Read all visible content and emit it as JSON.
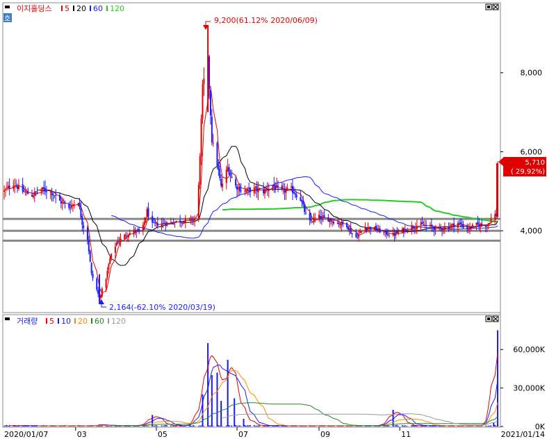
{
  "price_panel": {
    "legend": {
      "title": "이지홀딩스",
      "items": [
        {
          "label": "5",
          "color": "#e00000"
        },
        {
          "label": "20",
          "color": "#000000"
        },
        {
          "label": "60",
          "color": "#1a1aff"
        },
        {
          "label": "120",
          "color": "#22cc22"
        }
      ]
    },
    "corner_label": "호",
    "high_annotation": "9,200(61.12% 2020/06/09)",
    "low_annotation": "2,164(-62.10% 2020/03/19)",
    "current_price": "5,710",
    "current_change": "( 29.92%)",
    "y_ticks": [
      {
        "label": "8,000",
        "value": 8000
      },
      {
        "label": "6,000",
        "value": 6000
      },
      {
        "label": "4,000",
        "value": 4000
      }
    ],
    "support_lines": [
      4300,
      4000,
      3750
    ]
  },
  "volume_panel": {
    "legend": {
      "title": "거래량",
      "items": [
        {
          "label": "5",
          "color": "#e00000"
        },
        {
          "label": "10",
          "color": "#1a1aff"
        },
        {
          "label": "20",
          "color": "#ff8800"
        },
        {
          "label": "60",
          "color": "#228822"
        },
        {
          "label": "120",
          "color": "#999999"
        }
      ]
    },
    "y_ticks": [
      {
        "label": "60,000K",
        "value": 60000
      },
      {
        "label": "30,000K",
        "value": 30000
      },
      {
        "label": "0K",
        "value": 0
      }
    ]
  },
  "x_axis": {
    "start_label": "2020/01/07",
    "end_label": "2021/01/14",
    "ticks": [
      {
        "label": "03",
        "day": 54
      },
      {
        "label": "05",
        "day": 115
      },
      {
        "label": "07",
        "day": 176
      },
      {
        "label": "09",
        "day": 238
      },
      {
        "label": "11",
        "day": 299
      }
    ]
  },
  "chart_data": {
    "type": "candlestick",
    "x_range": [
      "2020/01/07",
      "2021/01/14"
    ],
    "ylim": [
      2000,
      9700
    ],
    "volume_ylim": [
      0,
      78000
    ],
    "high": {
      "date": "2020/06/09",
      "value": 9200,
      "change_pct": 61.12
    },
    "low": {
      "date": "2020/03/19",
      "value": 2164,
      "change_pct": -62.1
    },
    "last": {
      "date": "2021/01/14",
      "value": 5710,
      "change_pct": 29.92
    },
    "price_points": [
      [
        "2020/01/07",
        5000
      ],
      [
        "2020/01/14",
        5200
      ],
      [
        "2020/01/21",
        5000
      ],
      [
        "2020/01/28",
        4900
      ],
      [
        "2020/02/04",
        5050
      ],
      [
        "2020/02/11",
        5000
      ],
      [
        "2020/02/18",
        4750
      ],
      [
        "2020/02/25",
        4600
      ],
      [
        "2020/03/03",
        4750
      ],
      [
        "2020/03/06",
        4200
      ],
      [
        "2020/03/10",
        3800
      ],
      [
        "2020/03/13",
        2900
      ],
      [
        "2020/03/19",
        2300
      ],
      [
        "2020/03/24",
        2800
      ],
      [
        "2020/03/27",
        3300
      ],
      [
        "2020/04/01",
        3700
      ],
      [
        "2020/04/08",
        3900
      ],
      [
        "2020/04/15",
        4000
      ],
      [
        "2020/04/20",
        3950
      ],
      [
        "2020/04/24",
        4500
      ],
      [
        "2020/04/28",
        4150
      ],
      [
        "2020/06/01",
        4300
      ],
      [
        "2020/06/05",
        7600
      ],
      [
        "2020/06/09",
        8300
      ],
      [
        "2020/06/12",
        6300
      ],
      [
        "2020/06/16",
        5700
      ],
      [
        "2020/06/19",
        5100
      ],
      [
        "2020/06/24",
        5600
      ],
      [
        "2020/06/29",
        5150
      ],
      [
        "2020/07/06",
        5000
      ],
      [
        "2020/07/14",
        5050
      ],
      [
        "2020/07/21",
        5000
      ],
      [
        "2020/07/28",
        5150
      ],
      [
        "2020/08/04",
        5000
      ],
      [
        "2020/08/11",
        5050
      ],
      [
        "2020/08/18",
        4800
      ],
      [
        "2020/08/24",
        4200
      ],
      [
        "2020/08/31",
        4350
      ],
      [
        "2020/09/08",
        4300
      ],
      [
        "2020/09/15",
        4200
      ],
      [
        "2020/09/22",
        4150
      ],
      [
        "2020/09/28",
        3800
      ],
      [
        "2020/10/06",
        4100
      ],
      [
        "2020/10/13",
        4050
      ],
      [
        "2020/10/20",
        3950
      ],
      [
        "2020/10/27",
        3900
      ],
      [
        "2020/11/03",
        4000
      ],
      [
        "2020/11/10",
        4100
      ],
      [
        "2020/11/17",
        4150
      ],
      [
        "2020/11/24",
        4100
      ],
      [
        "2020/12/01",
        4050
      ],
      [
        "2020/12/08",
        4100
      ],
      [
        "2020/12/15",
        4200
      ],
      [
        "2020/12/22",
        4050
      ],
      [
        "2020/12/29",
        4150
      ],
      [
        "2021/01/06",
        4150
      ],
      [
        "2021/01/11",
        4400
      ],
      [
        "2021/01/13",
        4400
      ],
      [
        "2021/01/14",
        5710
      ]
    ],
    "volume_points": [
      [
        "2020/03/19",
        1500
      ],
      [
        "2020/04/28",
        9000
      ],
      [
        "2020/06/05",
        25000
      ],
      [
        "2020/06/09",
        65000
      ],
      [
        "2020/06/12",
        40000
      ],
      [
        "2020/06/16",
        42000
      ],
      [
        "2020/06/19",
        20000
      ],
      [
        "2020/06/24",
        52000
      ],
      [
        "2020/06/29",
        22000
      ],
      [
        "2020/07/06",
        6000
      ],
      [
        "2020/10/27",
        13000
      ],
      [
        "2021/01/11",
        3000
      ],
      [
        "2021/01/14",
        75000
      ]
    ]
  }
}
